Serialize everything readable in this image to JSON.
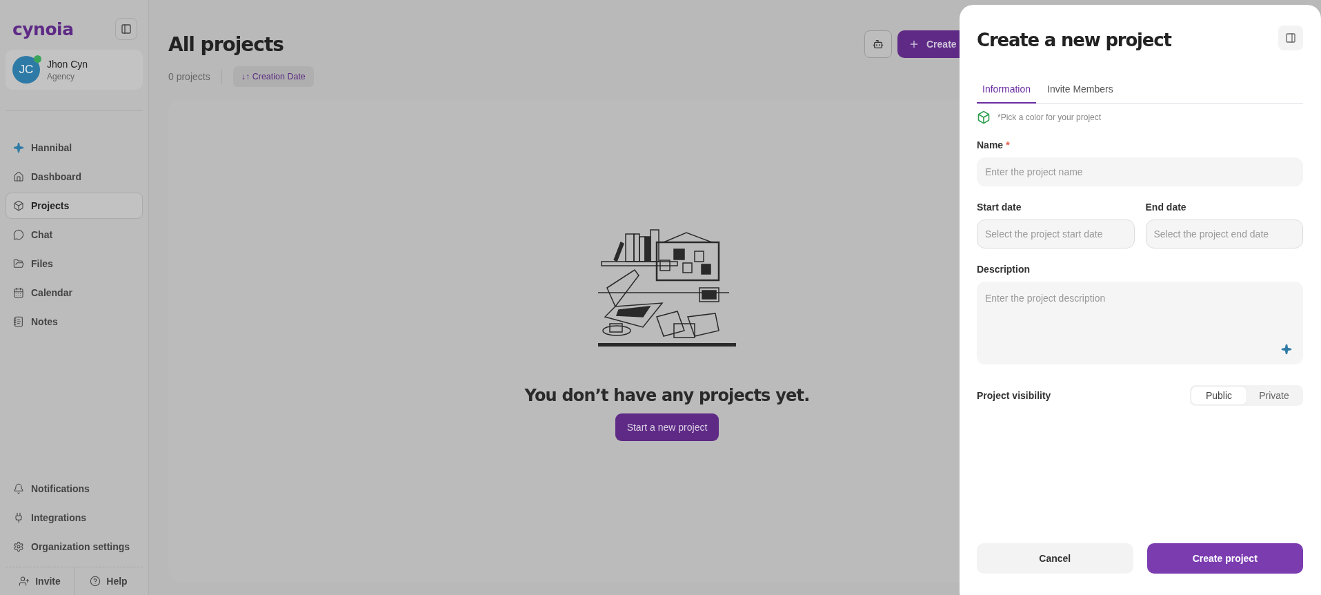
{
  "sidebar": {
    "logo": "cynoia",
    "user": {
      "initials": "JC",
      "name": "Jhon Cyn",
      "role": "Agency",
      "online": true
    },
    "items": [
      {
        "label": "Hannibal",
        "kind": "sparkle",
        "selected": false
      },
      {
        "label": "Dashboard",
        "kind": "house",
        "selected": false
      },
      {
        "label": "Projects",
        "kind": "box",
        "selected": true
      },
      {
        "label": "Chat",
        "kind": "chat",
        "selected": false
      },
      {
        "label": "Files",
        "kind": "folder",
        "selected": false
      },
      {
        "label": "Calendar",
        "kind": "calendar",
        "selected": false
      },
      {
        "label": "Notes",
        "kind": "note",
        "selected": false
      }
    ],
    "bottom_items": [
      {
        "label": "Notifications",
        "kind": "bell"
      },
      {
        "label": "Integrations",
        "kind": "plug"
      },
      {
        "label": "Organization settings",
        "kind": "gear"
      }
    ],
    "footer": [
      {
        "label": "Invite",
        "kind": "invite"
      },
      {
        "label": "Help",
        "kind": "help"
      }
    ]
  },
  "main": {
    "title": "All projects",
    "count": "0 projects",
    "sort": {
      "arrows": "↓↑",
      "label": "Creation Date"
    },
    "create_button": "Create",
    "empty": {
      "message": "You don’t have any projects yet.",
      "button": "Start a new project"
    }
  },
  "panel": {
    "title": "Create a new project",
    "tabs": [
      {
        "label": "Information",
        "selected": true
      },
      {
        "label": "Invite Members",
        "selected": false
      }
    ],
    "color_hint": "*Pick a color for your project",
    "fields": [
      {
        "label": "Name",
        "required": true,
        "placeholder": "Enter the project name",
        "kind": "text"
      },
      {
        "label": "Start date",
        "required": false,
        "placeholder": "Select the project start date",
        "kind": "date"
      },
      {
        "label": "End date",
        "required": false,
        "placeholder": "Select the project end date",
        "kind": "date"
      },
      {
        "label": "Description",
        "required": false,
        "placeholder": "Enter the project description",
        "kind": "textarea"
      }
    ],
    "required_mark": "*",
    "visibility": {
      "label": "Project visibility",
      "options": [
        {
          "label": "Public",
          "selected": true
        },
        {
          "label": "Private",
          "selected": false
        }
      ]
    },
    "buttons": [
      {
        "label": "Cancel",
        "kind": "secondary"
      },
      {
        "label": "Create project",
        "kind": "primary"
      }
    ]
  }
}
